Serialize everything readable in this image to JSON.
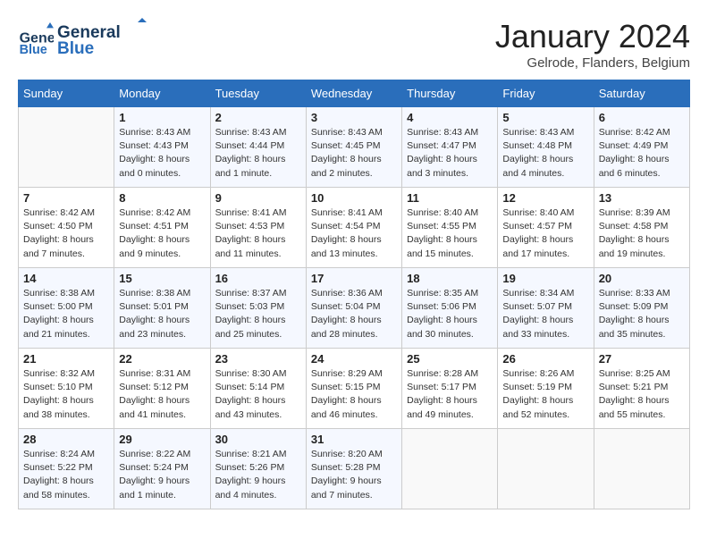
{
  "header": {
    "logo_line1": "General",
    "logo_line2": "Blue",
    "month": "January 2024",
    "location": "Gelrode, Flanders, Belgium"
  },
  "days_of_week": [
    "Sunday",
    "Monday",
    "Tuesday",
    "Wednesday",
    "Thursday",
    "Friday",
    "Saturday"
  ],
  "weeks": [
    [
      {
        "day": "",
        "sunrise": "",
        "sunset": "",
        "daylight": ""
      },
      {
        "day": "1",
        "sunrise": "Sunrise: 8:43 AM",
        "sunset": "Sunset: 4:43 PM",
        "daylight": "Daylight: 8 hours and 0 minutes."
      },
      {
        "day": "2",
        "sunrise": "Sunrise: 8:43 AM",
        "sunset": "Sunset: 4:44 PM",
        "daylight": "Daylight: 8 hours and 1 minute."
      },
      {
        "day": "3",
        "sunrise": "Sunrise: 8:43 AM",
        "sunset": "Sunset: 4:45 PM",
        "daylight": "Daylight: 8 hours and 2 minutes."
      },
      {
        "day": "4",
        "sunrise": "Sunrise: 8:43 AM",
        "sunset": "Sunset: 4:47 PM",
        "daylight": "Daylight: 8 hours and 3 minutes."
      },
      {
        "day": "5",
        "sunrise": "Sunrise: 8:43 AM",
        "sunset": "Sunset: 4:48 PM",
        "daylight": "Daylight: 8 hours and 4 minutes."
      },
      {
        "day": "6",
        "sunrise": "Sunrise: 8:42 AM",
        "sunset": "Sunset: 4:49 PM",
        "daylight": "Daylight: 8 hours and 6 minutes."
      }
    ],
    [
      {
        "day": "7",
        "sunrise": "Sunrise: 8:42 AM",
        "sunset": "Sunset: 4:50 PM",
        "daylight": "Daylight: 8 hours and 7 minutes."
      },
      {
        "day": "8",
        "sunrise": "Sunrise: 8:42 AM",
        "sunset": "Sunset: 4:51 PM",
        "daylight": "Daylight: 8 hours and 9 minutes."
      },
      {
        "day": "9",
        "sunrise": "Sunrise: 8:41 AM",
        "sunset": "Sunset: 4:53 PM",
        "daylight": "Daylight: 8 hours and 11 minutes."
      },
      {
        "day": "10",
        "sunrise": "Sunrise: 8:41 AM",
        "sunset": "Sunset: 4:54 PM",
        "daylight": "Daylight: 8 hours and 13 minutes."
      },
      {
        "day": "11",
        "sunrise": "Sunrise: 8:40 AM",
        "sunset": "Sunset: 4:55 PM",
        "daylight": "Daylight: 8 hours and 15 minutes."
      },
      {
        "day": "12",
        "sunrise": "Sunrise: 8:40 AM",
        "sunset": "Sunset: 4:57 PM",
        "daylight": "Daylight: 8 hours and 17 minutes."
      },
      {
        "day": "13",
        "sunrise": "Sunrise: 8:39 AM",
        "sunset": "Sunset: 4:58 PM",
        "daylight": "Daylight: 8 hours and 19 minutes."
      }
    ],
    [
      {
        "day": "14",
        "sunrise": "Sunrise: 8:38 AM",
        "sunset": "Sunset: 5:00 PM",
        "daylight": "Daylight: 8 hours and 21 minutes."
      },
      {
        "day": "15",
        "sunrise": "Sunrise: 8:38 AM",
        "sunset": "Sunset: 5:01 PM",
        "daylight": "Daylight: 8 hours and 23 minutes."
      },
      {
        "day": "16",
        "sunrise": "Sunrise: 8:37 AM",
        "sunset": "Sunset: 5:03 PM",
        "daylight": "Daylight: 8 hours and 25 minutes."
      },
      {
        "day": "17",
        "sunrise": "Sunrise: 8:36 AM",
        "sunset": "Sunset: 5:04 PM",
        "daylight": "Daylight: 8 hours and 28 minutes."
      },
      {
        "day": "18",
        "sunrise": "Sunrise: 8:35 AM",
        "sunset": "Sunset: 5:06 PM",
        "daylight": "Daylight: 8 hours and 30 minutes."
      },
      {
        "day": "19",
        "sunrise": "Sunrise: 8:34 AM",
        "sunset": "Sunset: 5:07 PM",
        "daylight": "Daylight: 8 hours and 33 minutes."
      },
      {
        "day": "20",
        "sunrise": "Sunrise: 8:33 AM",
        "sunset": "Sunset: 5:09 PM",
        "daylight": "Daylight: 8 hours and 35 minutes."
      }
    ],
    [
      {
        "day": "21",
        "sunrise": "Sunrise: 8:32 AM",
        "sunset": "Sunset: 5:10 PM",
        "daylight": "Daylight: 8 hours and 38 minutes."
      },
      {
        "day": "22",
        "sunrise": "Sunrise: 8:31 AM",
        "sunset": "Sunset: 5:12 PM",
        "daylight": "Daylight: 8 hours and 41 minutes."
      },
      {
        "day": "23",
        "sunrise": "Sunrise: 8:30 AM",
        "sunset": "Sunset: 5:14 PM",
        "daylight": "Daylight: 8 hours and 43 minutes."
      },
      {
        "day": "24",
        "sunrise": "Sunrise: 8:29 AM",
        "sunset": "Sunset: 5:15 PM",
        "daylight": "Daylight: 8 hours and 46 minutes."
      },
      {
        "day": "25",
        "sunrise": "Sunrise: 8:28 AM",
        "sunset": "Sunset: 5:17 PM",
        "daylight": "Daylight: 8 hours and 49 minutes."
      },
      {
        "day": "26",
        "sunrise": "Sunrise: 8:26 AM",
        "sunset": "Sunset: 5:19 PM",
        "daylight": "Daylight: 8 hours and 52 minutes."
      },
      {
        "day": "27",
        "sunrise": "Sunrise: 8:25 AM",
        "sunset": "Sunset: 5:21 PM",
        "daylight": "Daylight: 8 hours and 55 minutes."
      }
    ],
    [
      {
        "day": "28",
        "sunrise": "Sunrise: 8:24 AM",
        "sunset": "Sunset: 5:22 PM",
        "daylight": "Daylight: 8 hours and 58 minutes."
      },
      {
        "day": "29",
        "sunrise": "Sunrise: 8:22 AM",
        "sunset": "Sunset: 5:24 PM",
        "daylight": "Daylight: 9 hours and 1 minute."
      },
      {
        "day": "30",
        "sunrise": "Sunrise: 8:21 AM",
        "sunset": "Sunset: 5:26 PM",
        "daylight": "Daylight: 9 hours and 4 minutes."
      },
      {
        "day": "31",
        "sunrise": "Sunrise: 8:20 AM",
        "sunset": "Sunset: 5:28 PM",
        "daylight": "Daylight: 9 hours and 7 minutes."
      },
      {
        "day": "",
        "sunrise": "",
        "sunset": "",
        "daylight": ""
      },
      {
        "day": "",
        "sunrise": "",
        "sunset": "",
        "daylight": ""
      },
      {
        "day": "",
        "sunrise": "",
        "sunset": "",
        "daylight": ""
      }
    ]
  ]
}
